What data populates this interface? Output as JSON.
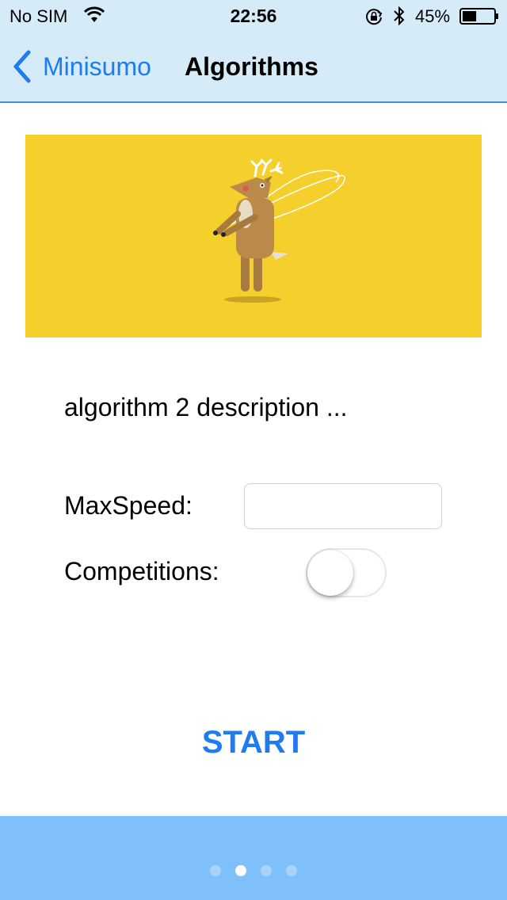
{
  "status_bar": {
    "carrier": "No SIM",
    "time": "22:56",
    "battery_percent": "45%",
    "battery_level": 0.45,
    "icons": [
      "wifi-icon",
      "orientation-lock-icon",
      "bluetooth-icon",
      "battery-icon"
    ]
  },
  "nav": {
    "back_label": "Minisumo",
    "back_icon": "chevron-left-icon",
    "title": "Algorithms"
  },
  "banner": {
    "background_color": "#f5cf2b",
    "illustration": "deer-jump-rope-illustration"
  },
  "description": "algorithm 2 description ...",
  "form": {
    "max_speed_label": "MaxSpeed:",
    "max_speed_value": "",
    "competitions_label": "Competitions:",
    "competitions_enabled": false
  },
  "start_label": "START",
  "pager": {
    "page_count": 4,
    "current_page": 2
  },
  "colors": {
    "accent": "#1e7bf0",
    "nav_background": "#d6ebf8",
    "bottom_bar": "#7fc0fb"
  }
}
